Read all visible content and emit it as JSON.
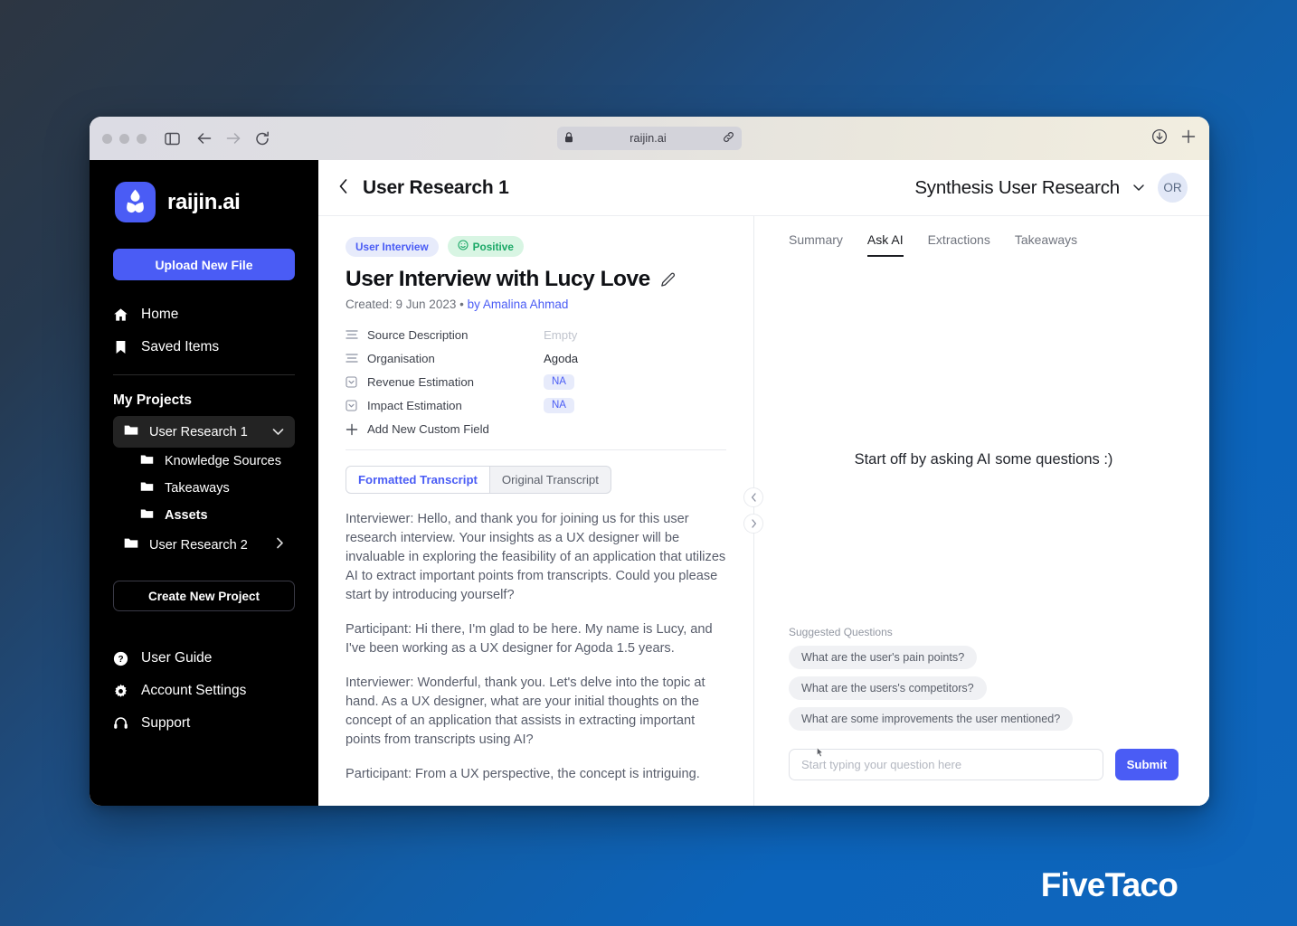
{
  "browser": {
    "url": "raijin.ai",
    "lock_icon": "lock-icon",
    "link_icon": "link-icon",
    "back_icon": "back-arrow-icon",
    "forward_icon": "forward-arrow-icon",
    "reload_icon": "reload-icon",
    "sidebar_toggle_icon": "sidebar-toggle-icon",
    "download_icon": "download-icon",
    "newtab_icon": "plus-icon"
  },
  "sidebar": {
    "brand": "raijin.ai",
    "logo_icon": "raijin-logo-icon",
    "upload_label": "Upload New File",
    "nav": [
      {
        "label": "Home",
        "icon": "home-icon"
      },
      {
        "label": "Saved Items",
        "icon": "bookmark-icon"
      }
    ],
    "section_title": "My Projects",
    "projects": [
      {
        "label": "User Research 1",
        "icon": "folder-icon",
        "chevron": "chevron-down-icon",
        "active": true
      },
      {
        "label": "User Research 2",
        "icon": "folder-icon",
        "chevron": "chevron-right-icon",
        "active": false
      }
    ],
    "subitems": [
      {
        "label": "Knowledge Sources",
        "icon": "folder-icon"
      },
      {
        "label": "Takeaways",
        "icon": "folder-icon"
      },
      {
        "label": "Assets",
        "icon": "folder-icon"
      }
    ],
    "create_label": "Create New Project",
    "bottom_nav": [
      {
        "label": "User Guide",
        "icon": "question-circle-icon"
      },
      {
        "label": "Account Settings",
        "icon": "gear-icon"
      },
      {
        "label": "Support",
        "icon": "headset-icon"
      }
    ]
  },
  "topbar": {
    "back_icon": "chevron-left-icon",
    "title": "User Research 1",
    "workspace": "Synthesis User Research",
    "workspace_chevron": "chevron-down-icon",
    "avatar_initials": "OR"
  },
  "document": {
    "tag": "User Interview",
    "sentiment": "Positive",
    "sentiment_icon": "smiley-icon",
    "title": "User Interview with Lucy Love",
    "edit_icon": "pencil-icon",
    "created_prefix": "Created: 9 Jun 2023",
    "created_sep": "•",
    "author": "by Amalina Ahmad",
    "fields": [
      {
        "icon": "text-lines-icon",
        "label": "Source Description",
        "value": "Empty",
        "style": "empty"
      },
      {
        "icon": "text-lines-icon",
        "label": "Organisation",
        "value": "Agoda",
        "style": "plain"
      },
      {
        "icon": "select-box-icon",
        "label": "Revenue Estimation",
        "value": "NA",
        "style": "tag"
      },
      {
        "icon": "select-box-icon",
        "label": "Impact Estimation",
        "value": "NA",
        "style": "tag"
      }
    ],
    "add_field_label": "Add New Custom Field",
    "add_field_icon": "plus-icon",
    "segments": [
      {
        "label": "Formatted Transcript",
        "active": true
      },
      {
        "label": "Original Transcript",
        "active": false
      }
    ],
    "transcript": [
      "Interviewer: Hello, and thank you for joining us for this user research interview. Your insights as a UX designer will be invaluable in exploring the feasibility of an application that utilizes AI to extract important points from transcripts. Could you please start by introducing yourself?",
      "Participant: Hi there, I'm glad to be here. My name is Lucy, and I've been working as a UX designer for Agoda 1.5 years.",
      "Interviewer: Wonderful, thank you. Let's delve into the topic at hand. As a UX designer, what are your initial thoughts on the concept of an application that assists in extracting important points from transcripts using AI?",
      "Participant: From a UX perspective, the concept is intriguing."
    ]
  },
  "panel_handles": {
    "collapse_left_icon": "chevron-left-icon",
    "collapse_right_icon": "chevron-right-icon"
  },
  "right_panel": {
    "tabs": [
      {
        "label": "Summary",
        "active": false
      },
      {
        "label": "Ask AI",
        "active": true
      },
      {
        "label": "Extractions",
        "active": false
      },
      {
        "label": "Takeaways",
        "active": false
      }
    ],
    "empty_state": "Start off by asking AI some questions :)",
    "suggested_label": "Suggested Questions",
    "suggested": [
      "What are the user's pain points?",
      "What are the users's competitors?",
      "What are some improvements the user mentioned?"
    ],
    "input_placeholder": "Start typing your question here",
    "input_value": "",
    "submit_label": "Submit"
  },
  "watermark": "FiveTaco",
  "colors": {
    "accent": "#4a5cf5",
    "sidebar_bg": "#000000",
    "positive": "#1aa866",
    "bg_top": "#2d3642",
    "bg_bottom": "#0f66bc"
  }
}
